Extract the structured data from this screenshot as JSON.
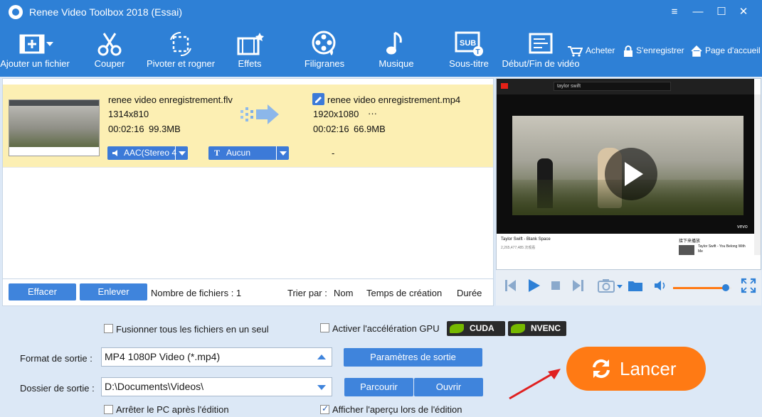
{
  "window": {
    "title": "Renee Video Toolbox 2018 (Essai)",
    "controls": {
      "menu": "≡",
      "minimize": "—",
      "maximize": "☐",
      "close": "✕"
    }
  },
  "toolbar": {
    "tools": [
      {
        "label": "Ajouter un fichier",
        "icon": "add-file-icon"
      },
      {
        "label": "Couper",
        "icon": "scissors-icon"
      },
      {
        "label": "Pivoter et rogner",
        "icon": "rotate-crop-icon"
      },
      {
        "label": "Effets",
        "icon": "effects-icon"
      },
      {
        "label": "Filigranes",
        "icon": "watermark-icon"
      },
      {
        "label": "Musique",
        "icon": "music-icon"
      },
      {
        "label": "Sous-titre",
        "icon": "subtitle-icon"
      },
      {
        "label": "Début/Fin de vidéo",
        "icon": "intro-outro-icon"
      }
    ],
    "links": {
      "buy": "Acheter",
      "register": "S'enregistrer",
      "home": "Page d'accueil"
    }
  },
  "file": {
    "source": {
      "name": "renee video enregistrement.flv",
      "resolution": "1314x810",
      "duration": "00:02:16",
      "size": "99.3MB"
    },
    "output": {
      "name": "renee video enregistrement.mp4",
      "resolution": "1920x1080",
      "more": "···",
      "duration": "00:02:16",
      "size": "66.9MB"
    },
    "audio_track": "AAC(Stereo 4",
    "subtitle": "Aucun",
    "subtitle_output": "-"
  },
  "list_footer": {
    "clear_label": "Effacer",
    "remove_label": "Enlever",
    "file_count": "Nombre de fichiers : 1",
    "sort_by": "Trier par :",
    "sort_name": "Nom",
    "sort_time": "Temps de création",
    "sort_duration": "Durée"
  },
  "preview": {
    "video_title": "Taylor Swift - Blank Space",
    "search_text": "taylor swift",
    "views": "2,265,477,485 次观看",
    "up_next": "接下来播放",
    "next_video": "Taylor Swift - You Belong With Me",
    "vevo": "vevo",
    "volume": 0.9
  },
  "settings": {
    "merge_label": "Fusionner tous les fichiers en un seul",
    "merge_checked": false,
    "gpu_label": "Activer l'accélération GPU",
    "gpu_checked": false,
    "cuda": "CUDA",
    "nvenc": "NVENC",
    "format_label": "Format de sortie :",
    "format_value": "MP4 1080P Video (*.mp4)",
    "output_params": "Paramètres de sortie",
    "folder_label": "Dossier de sortie :",
    "folder_value": "D:\\Documents\\Videos\\",
    "browse": "Parcourir",
    "open": "Ouvrir",
    "shutdown_label": "Arrêter le PC après l'édition",
    "shutdown_checked": false,
    "preview_label": "Afficher l'aperçu lors de l'édition",
    "preview_checked": true,
    "launch_label": "Lancer"
  },
  "colors": {
    "primary": "#2e80d6",
    "button": "#3f84dc",
    "selected_row": "#fcefb3",
    "launch": "#ff7a14",
    "annotation_arrow": "#e02020",
    "nvidia_green": "#76b900"
  }
}
